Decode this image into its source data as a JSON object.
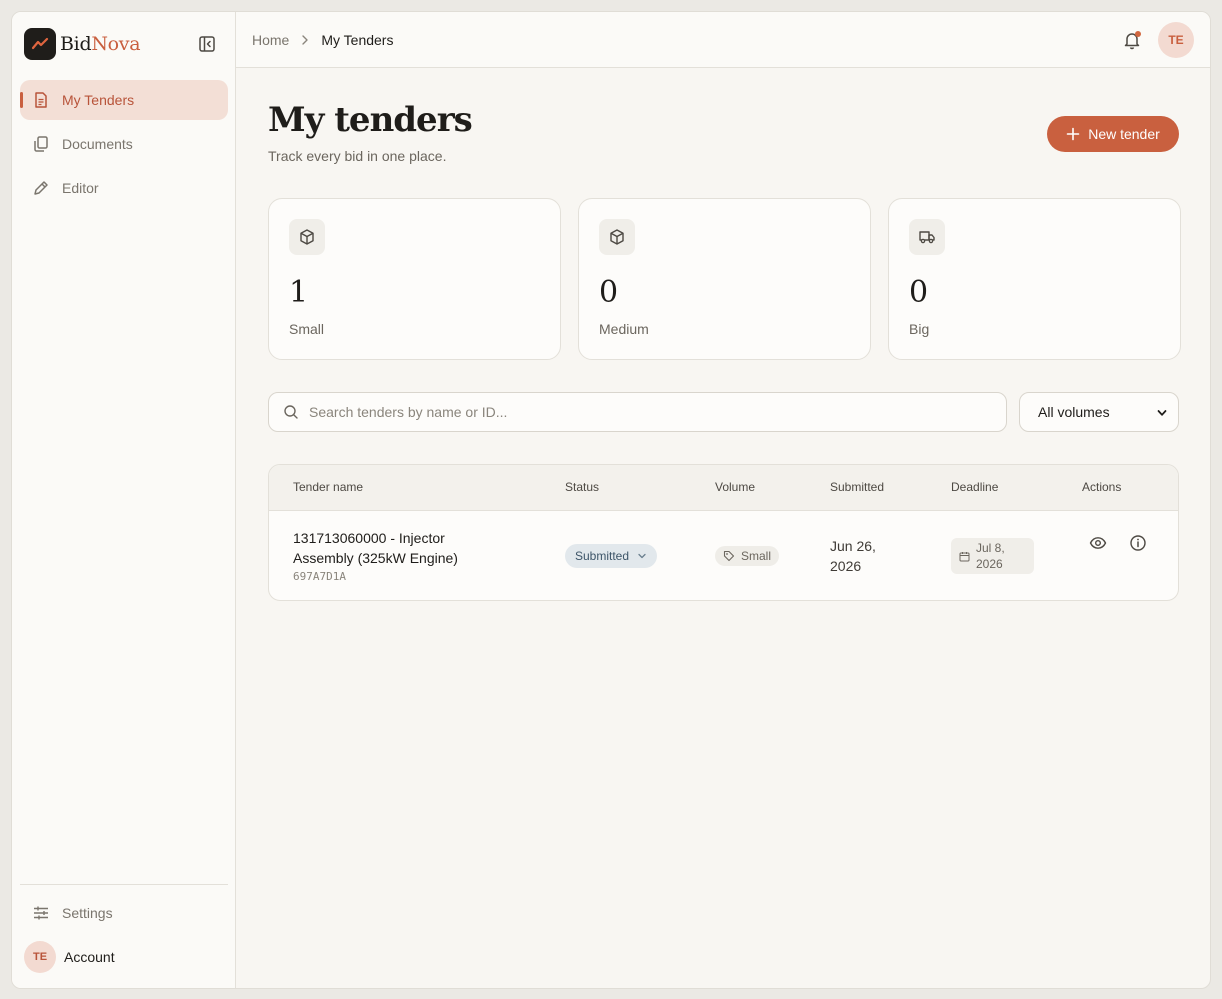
{
  "brand": {
    "name_part1": "Bid",
    "name_part2": "Nova"
  },
  "sidebar": {
    "items": [
      {
        "label": "My Tenders",
        "icon": "file-text-icon",
        "active": true
      },
      {
        "label": "Documents",
        "icon": "copy-icon",
        "active": false
      },
      {
        "label": "Editor",
        "icon": "pencil-icon",
        "active": false
      }
    ],
    "settings_label": "Settings",
    "account_label": "Account",
    "account_initials": "TE"
  },
  "breadcrumb": {
    "home": "Home",
    "current": "My Tenders"
  },
  "user": {
    "initials": "TE"
  },
  "page": {
    "title": "My tenders",
    "subtitle": "Track every bid in one place.",
    "new_button": "New tender"
  },
  "stats": [
    {
      "value": "1",
      "label": "Small",
      "icon": "box-icon"
    },
    {
      "value": "0",
      "label": "Medium",
      "icon": "box-icon"
    },
    {
      "value": "0",
      "label": "Big",
      "icon": "truck-icon"
    }
  ],
  "search": {
    "placeholder": "Search tenders by name or ID..."
  },
  "filter": {
    "selected": "All volumes"
  },
  "table": {
    "columns": [
      "Tender name",
      "Status",
      "Volume",
      "Submitted",
      "Deadline",
      "Actions"
    ],
    "rows": [
      {
        "name": "131713060000 - Injector Assembly (325kW Engine)",
        "id": "697A7D1A",
        "status": "Submitted",
        "volume": "Small",
        "submitted": "Jun 26, 2026",
        "deadline": "Jul 8, 2026"
      }
    ]
  },
  "colors": {
    "accent": "#c9603f",
    "active_bg": "#f3dfd6",
    "status_bg": "#e2e8ec"
  }
}
